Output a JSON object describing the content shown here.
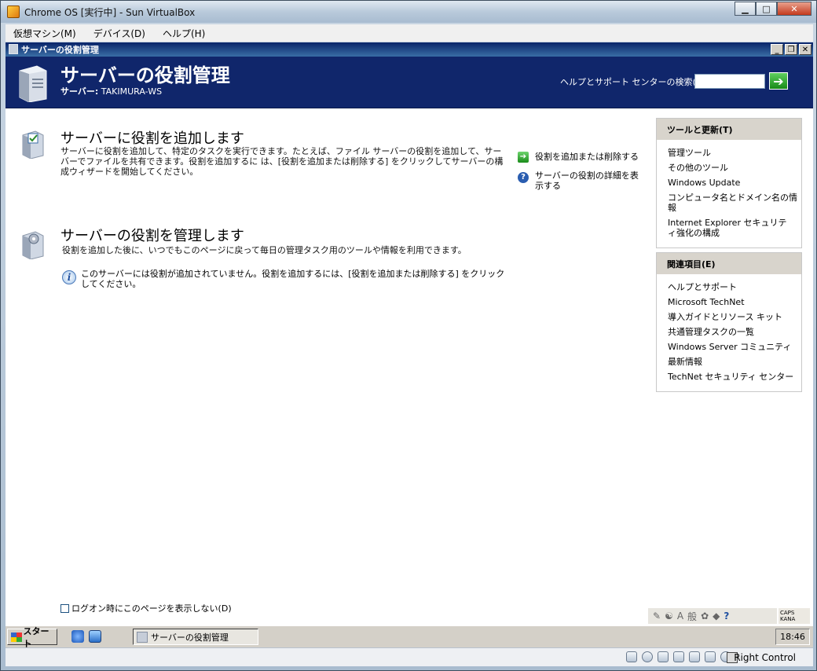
{
  "window": {
    "title": "Chrome OS [実行中] - Sun VirtualBox",
    "menu": [
      "仮想マシン(M)",
      "デバイス(D)",
      "ヘルプ(H)"
    ],
    "host_key": "Right Control"
  },
  "inner_window": {
    "title": "サーバーの役割管理"
  },
  "header": {
    "title": "サーバーの役割管理",
    "server_label": "サーバー:",
    "server_name": "TAKIMURA-WS",
    "help_search_label": "ヘルプとサポート センターの検索(S)",
    "help_search_value": "",
    "go_symbol": "➔"
  },
  "add_section": {
    "title": "サーバーに役割を追加します",
    "description": "サーバーに役割を追加して、特定のタスクを実行できます。たとえば、ファイル サーバーの役割を追加して、サーバーでファイルを共有できます。役割を追加するに は、[役割を追加または削除する] をクリックしてサーバーの構成ウィザードを開始してください。",
    "add_remove_link": "役割を追加または削除する",
    "details_link": "サーバーの役割の詳細を表示する"
  },
  "manage_section": {
    "title": "サーバーの役割を管理します",
    "description": "役割を追加した後に、いつでもこのページに戻って毎日の管理タスク用のツールや情報を利用できます。",
    "info": "このサーバーには役割が追加されていません。役割を追加するには、[役割を追加または削除する] をクリックしてください。"
  },
  "tools_panel": {
    "title": "ツールと更新(T)",
    "items": [
      "管理ツール",
      "その他のツール",
      "Windows Update",
      "コンピュータ名とドメイン名の情報",
      "Internet Explorer セキュリティ強化の構成"
    ]
  },
  "related_panel": {
    "title": "関連項目(E)",
    "items": [
      "ヘルプとサポート",
      "Microsoft TechNet",
      "導入ガイドとリソース キット",
      "共通管理タスクの一覧",
      "Windows Server コミュニティ",
      "最新情報",
      "TechNet セキュリティ センター"
    ]
  },
  "footer": {
    "dont_show_label": "ログオン時にこのページを表示しない(D)",
    "dont_show_checked": false
  },
  "taskbar": {
    "start_label": "スタート",
    "task_button": "サーバーの役割管理",
    "clock": "18:46",
    "ime_text": "般",
    "caps": "CAPS",
    "kana": "KANA"
  }
}
